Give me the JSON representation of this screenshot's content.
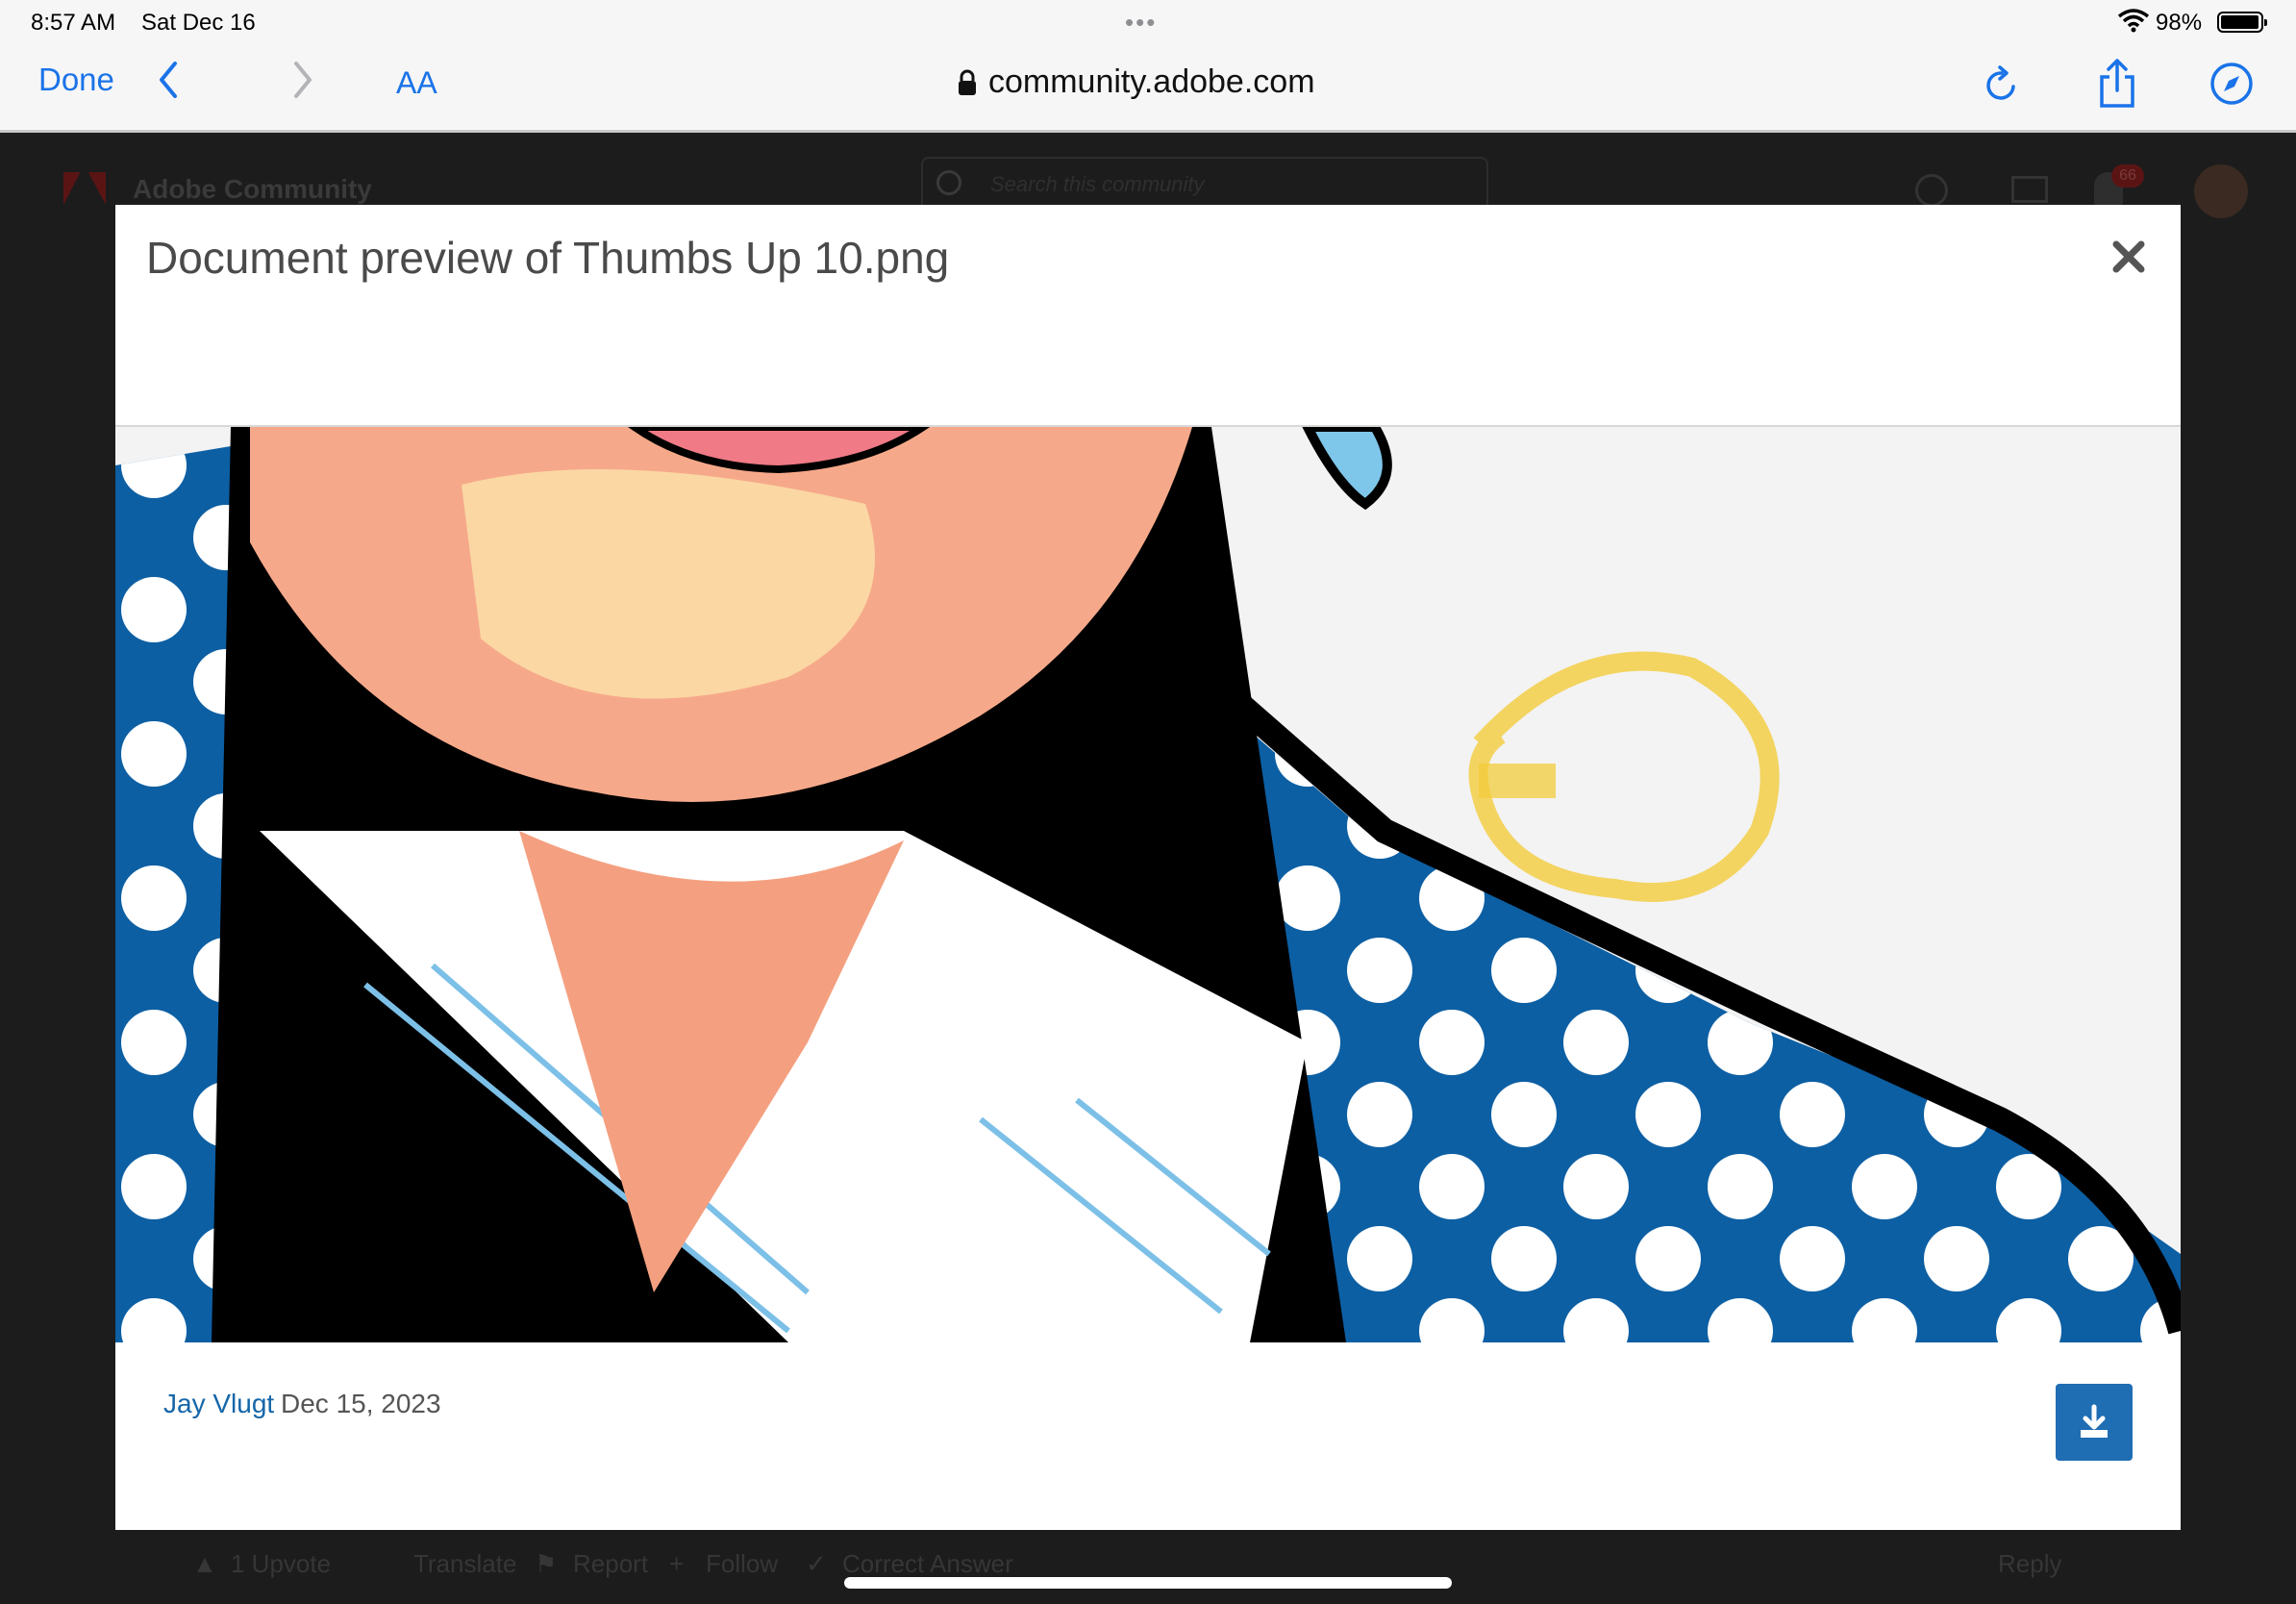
{
  "status_bar": {
    "time": "8:57 AM",
    "date": "Sat Dec 16",
    "battery_percent": "98%",
    "battery_level": 0.98
  },
  "browser": {
    "done_label": "Done",
    "text_size_label": "AA",
    "url": "community.adobe.com",
    "accent_color": "#1a73e8"
  },
  "background_page": {
    "site_title": "Adobe Community",
    "search_placeholder": "Search this community",
    "notification_count": "66",
    "actions": {
      "upvote": "1 Upvote",
      "translate": "Translate",
      "report": "Report",
      "follow": "Follow",
      "correct_answer": "Correct Answer",
      "reply": "Reply"
    }
  },
  "modal": {
    "title": "Document preview of Thumbs Up 10.png",
    "author": "Jay Vlugt",
    "date": "Dec 15, 2023",
    "download_color": "#1f6db3"
  }
}
